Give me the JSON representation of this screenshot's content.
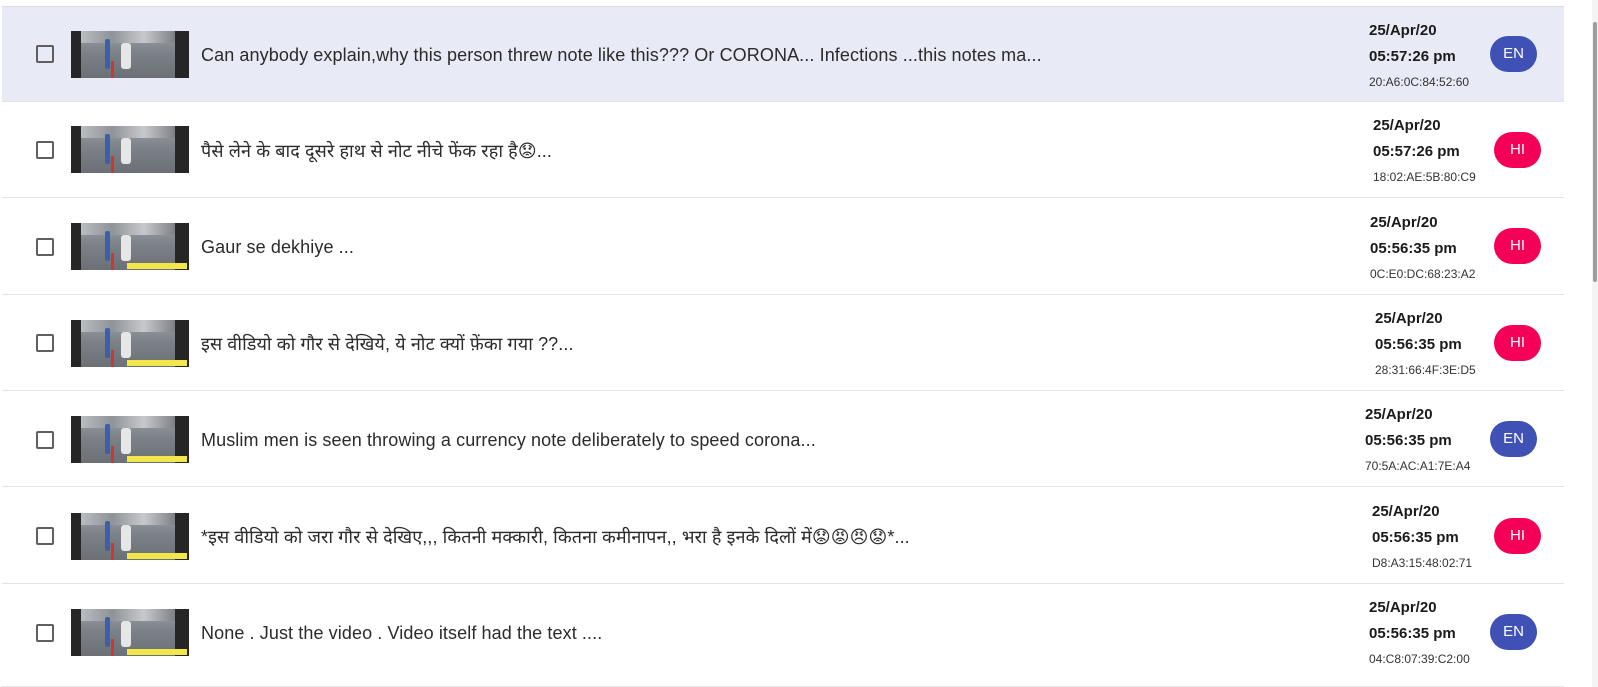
{
  "messages": [
    {
      "text": "Can anybody explain,why this person threw note like this??? Or CORONA... Infections ...this notes ma...",
      "date": "25/Apr/20",
      "time": "05:57:26 pm",
      "mac": "20:A6:0C:84:52:60",
      "lang": "EN",
      "selected": true
    },
    {
      "text": "पैसे लेने के बाद दूसरे हाथ से नोट नीचे फेंक रहा है😟...",
      "date": "25/Apr/20",
      "time": "05:57:26 pm",
      "mac": "18:02:AE:5B:80:C9",
      "lang": "HI",
      "selected": false
    },
    {
      "text": "Gaur se dekhiye ...",
      "date": "25/Apr/20",
      "time": "05:56:35 pm",
      "mac": "0C:E0:DC:68:23:A2",
      "lang": "HI",
      "selected": false
    },
    {
      "text": "इस वीडियो को गौर से देखिये, ये नोट क्यों फ़ेंका गया ??...",
      "date": "25/Apr/20",
      "time": "05:56:35 pm",
      "mac": "28:31:66:4F:3E:D5",
      "lang": "HI",
      "selected": false
    },
    {
      "text": "Muslim men is seen throwing a currency note deliberately to speed corona...",
      "date": "25/Apr/20",
      "time": "05:56:35 pm",
      "mac": "70:5A:AC:A1:7E:A4",
      "lang": "EN",
      "selected": false
    },
    {
      "text": "*इस वीडियो को जरा गौर से देखिए,,, कितनी मक्कारी, कितना कमीनापन,, भरा है इनके दिलों में😟😡😠😟*...",
      "date": "25/Apr/20",
      "time": "05:56:35 pm",
      "mac": "D8:A3:15:48:02:71",
      "lang": "HI",
      "selected": false
    },
    {
      "text": "None . Just the video . Video itself had the text ....",
      "date": "25/Apr/20",
      "time": "05:56:35 pm",
      "mac": "04:C8:07:39:C2:00",
      "lang": "EN",
      "selected": false
    }
  ],
  "colors": {
    "selected_row": "#e8eaf6",
    "lang_en": "#3f51b5",
    "lang_hi": "#f50057"
  },
  "icons": {
    "checkbox": "checkbox-unchecked-icon",
    "thumbnail": "video-thumbnail"
  }
}
